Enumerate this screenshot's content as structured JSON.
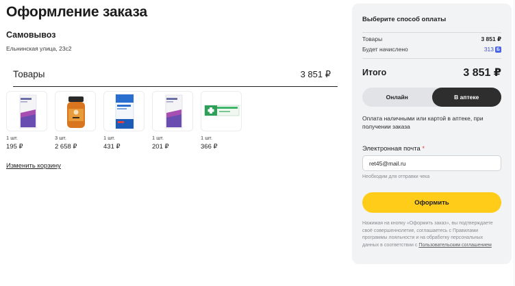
{
  "page": {
    "title": "Оформление заказа"
  },
  "pickup": {
    "title": "Самовывоз",
    "address": "Ельнинская улица, 23с2"
  },
  "goods": {
    "title": "Товары",
    "total": "3 851 ₽",
    "items": [
      {
        "qty": "1 шт.",
        "price": "195 ₽",
        "image": "medicine-box-purple-icon"
      },
      {
        "qty": "3 шт.",
        "price": "2 658 ₽",
        "image": "supplement-jar-orange-icon"
      },
      {
        "qty": "1 шт.",
        "price": "431 ₽",
        "image": "medicine-box-blue-icon"
      },
      {
        "qty": "1 шт.",
        "price": "201 ₽",
        "image": "medicine-box-purple-icon"
      },
      {
        "qty": "1 шт.",
        "price": "366 ₽",
        "image": "ointment-tube-green-icon"
      }
    ],
    "edit_link": "Изменить корзину"
  },
  "payment": {
    "title": "Выберите способ оплаты",
    "goods_label": "Товары",
    "goods_value": "3 851 ₽",
    "bonus_label": "Будет начислено",
    "bonus_value": "313",
    "bonus_icon": "Б",
    "total_label": "Итого",
    "total_value": "3 851 ₽",
    "options": [
      {
        "label": "Онлайн",
        "active": false
      },
      {
        "label": "В аптеке",
        "active": true
      }
    ],
    "description": "Оплата наличными или картой в аптеке, при получении заказа",
    "email_label": "Электронная почта",
    "email_required_mark": "*",
    "email_value": "ret45@mail.ru",
    "email_hint": "Необходим для отправки чека",
    "submit_label": "Оформить",
    "legal_text": "Нажимая на кнопку «Оформить заказ», вы подтверждаете своё совершеннолетие, соглашаетесь с Правилами программы лояльности и на обработку персональных данных в соответствии с",
    "legal_link": "Пользовательским соглашением"
  },
  "colors": {
    "accent": "#ffcc1a",
    "dark": "#2e2e2e",
    "panel": "#f2f3f5",
    "bonus": "#4a63e7"
  }
}
